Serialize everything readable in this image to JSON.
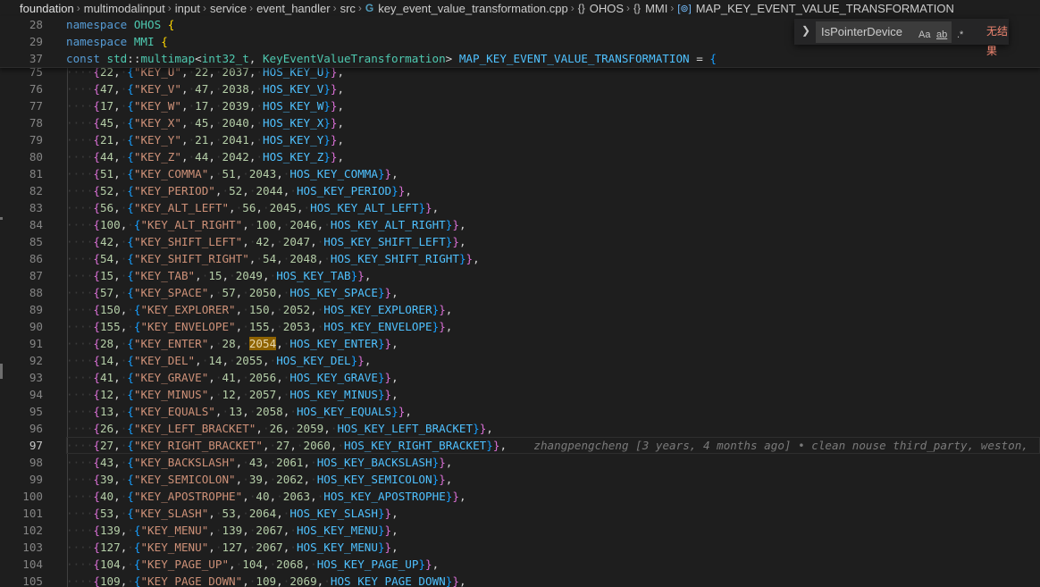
{
  "breadcrumb": [
    {
      "label": "foundation",
      "icon": ""
    },
    {
      "label": "multimodalinput",
      "icon": ""
    },
    {
      "label": "input",
      "icon": ""
    },
    {
      "label": "service",
      "icon": ""
    },
    {
      "label": "event_handler",
      "icon": ""
    },
    {
      "label": "src",
      "icon": ""
    },
    {
      "label": "key_event_value_transformation.cpp",
      "icon": "cpp-file-icon"
    },
    {
      "label": "OHOS",
      "icon": "namespace-icon"
    },
    {
      "label": "MMI",
      "icon": "namespace-icon"
    },
    {
      "label": "MAP_KEY_EVENT_VALUE_TRANSFORMATION",
      "icon": "variable-icon"
    }
  ],
  "sticky": [
    {
      "n": "28",
      "t": "namespace OHOS {"
    },
    {
      "n": "29",
      "t": "namespace MMI {"
    },
    {
      "n": "37",
      "t": "const std::multimap<int32_t, KeyEventValueTransformation> MAP_KEY_EVENT_VALUE_TRANSFORMATION = {"
    }
  ],
  "find": {
    "query": "IsPointerDevice",
    "match_case": "Aa",
    "whole_word": "ab",
    "regex": ".*",
    "result": "无结果"
  },
  "current_line": "97",
  "highlight_line": "91",
  "highlight_value": "2054",
  "blame": "zhangpengcheng [3 years, 4 months ago] • clean nouse third_party, weston,",
  "rows": [
    {
      "n": "75",
      "code": "22",
      "key": "KEY_U",
      "a": "22",
      "b": "2037",
      "hos": "HOS_KEY_U"
    },
    {
      "n": "76",
      "code": "47",
      "key": "KEY_V",
      "a": "47",
      "b": "2038",
      "hos": "HOS_KEY_V"
    },
    {
      "n": "77",
      "code": "17",
      "key": "KEY_W",
      "a": "17",
      "b": "2039",
      "hos": "HOS_KEY_W"
    },
    {
      "n": "78",
      "code": "45",
      "key": "KEY_X",
      "a": "45",
      "b": "2040",
      "hos": "HOS_KEY_X"
    },
    {
      "n": "79",
      "code": "21",
      "key": "KEY_Y",
      "a": "21",
      "b": "2041",
      "hos": "HOS_KEY_Y"
    },
    {
      "n": "80",
      "code": "44",
      "key": "KEY_Z",
      "a": "44",
      "b": "2042",
      "hos": "HOS_KEY_Z"
    },
    {
      "n": "81",
      "code": "51",
      "key": "KEY_COMMA",
      "a": "51",
      "b": "2043",
      "hos": "HOS_KEY_COMMA"
    },
    {
      "n": "82",
      "code": "52",
      "key": "KEY_PERIOD",
      "a": "52",
      "b": "2044",
      "hos": "HOS_KEY_PERIOD"
    },
    {
      "n": "83",
      "code": "56",
      "key": "KEY_ALT_LEFT",
      "a": "56",
      "b": "2045",
      "hos": "HOS_KEY_ALT_LEFT"
    },
    {
      "n": "84",
      "code": "100",
      "key": "KEY_ALT_RIGHT",
      "a": "100",
      "b": "2046",
      "hos": "HOS_KEY_ALT_RIGHT"
    },
    {
      "n": "85",
      "code": "42",
      "key": "KEY_SHIFT_LEFT",
      "a": "42",
      "b": "2047",
      "hos": "HOS_KEY_SHIFT_LEFT"
    },
    {
      "n": "86",
      "code": "54",
      "key": "KEY_SHIFT_RIGHT",
      "a": "54",
      "b": "2048",
      "hos": "HOS_KEY_SHIFT_RIGHT"
    },
    {
      "n": "87",
      "code": "15",
      "key": "KEY_TAB",
      "a": "15",
      "b": "2049",
      "hos": "HOS_KEY_TAB"
    },
    {
      "n": "88",
      "code": "57",
      "key": "KEY_SPACE",
      "a": "57",
      "b": "2050",
      "hos": "HOS_KEY_SPACE"
    },
    {
      "n": "89",
      "code": "150",
      "key": "KEY_EXPLORER",
      "a": "150",
      "b": "2052",
      "hos": "HOS_KEY_EXPLORER"
    },
    {
      "n": "90",
      "code": "155",
      "key": "KEY_ENVELOPE",
      "a": "155",
      "b": "2053",
      "hos": "HOS_KEY_ENVELOPE"
    },
    {
      "n": "91",
      "code": "28",
      "key": "KEY_ENTER",
      "a": "28",
      "b": "2054",
      "hos": "HOS_KEY_ENTER"
    },
    {
      "n": "92",
      "code": "14",
      "key": "KEY_DEL",
      "a": "14",
      "b": "2055",
      "hos": "HOS_KEY_DEL"
    },
    {
      "n": "93",
      "code": "41",
      "key": "KEY_GRAVE",
      "a": "41",
      "b": "2056",
      "hos": "HOS_KEY_GRAVE"
    },
    {
      "n": "94",
      "code": "12",
      "key": "KEY_MINUS",
      "a": "12",
      "b": "2057",
      "hos": "HOS_KEY_MINUS"
    },
    {
      "n": "95",
      "code": "13",
      "key": "KEY_EQUALS",
      "a": "13",
      "b": "2058",
      "hos": "HOS_KEY_EQUALS"
    },
    {
      "n": "96",
      "code": "26",
      "key": "KEY_LEFT_BRACKET",
      "a": "26",
      "b": "2059",
      "hos": "HOS_KEY_LEFT_BRACKET"
    },
    {
      "n": "97",
      "code": "27",
      "key": "KEY_RIGHT_BRACKET",
      "a": "27",
      "b": "2060",
      "hos": "HOS_KEY_RIGHT_BRACKET"
    },
    {
      "n": "98",
      "code": "43",
      "key": "KEY_BACKSLASH",
      "a": "43",
      "b": "2061",
      "hos": "HOS_KEY_BACKSLASH"
    },
    {
      "n": "99",
      "code": "39",
      "key": "KEY_SEMICOLON",
      "a": "39",
      "b": "2062",
      "hos": "HOS_KEY_SEMICOLON"
    },
    {
      "n": "100",
      "code": "40",
      "key": "KEY_APOSTROPHE",
      "a": "40",
      "b": "2063",
      "hos": "HOS_KEY_APOSTROPHE"
    },
    {
      "n": "101",
      "code": "53",
      "key": "KEY_SLASH",
      "a": "53",
      "b": "2064",
      "hos": "HOS_KEY_SLASH"
    },
    {
      "n": "102",
      "code": "139",
      "key": "KEY_MENU",
      "a": "139",
      "b": "2067",
      "hos": "HOS_KEY_MENU"
    },
    {
      "n": "103",
      "code": "127",
      "key": "KEY_MENU",
      "a": "127",
      "b": "2067",
      "hos": "HOS_KEY_MENU"
    },
    {
      "n": "104",
      "code": "104",
      "key": "KEY_PAGE_UP",
      "a": "104",
      "b": "2068",
      "hos": "HOS_KEY_PAGE_UP"
    },
    {
      "n": "105",
      "code": "109",
      "key": "KEY_PAGE_DOWN",
      "a": "109",
      "b": "2069",
      "hos": "HOS_KEY_PAGE_DOWN"
    }
  ]
}
